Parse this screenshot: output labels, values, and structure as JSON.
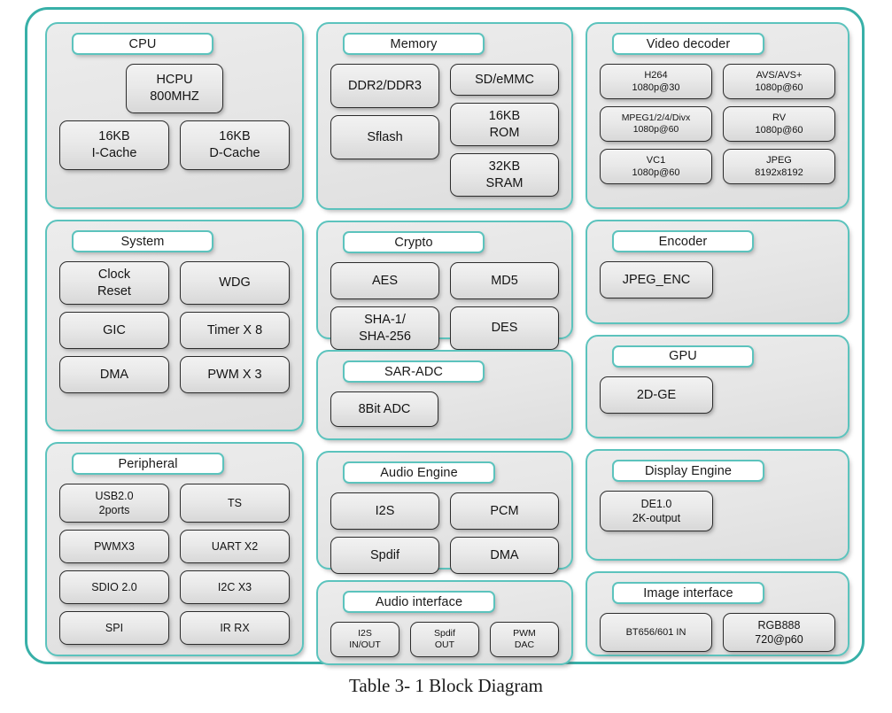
{
  "caption": "Table 3- 1 Block Diagram",
  "colors": {
    "group_border": "#5cc3bd",
    "frame_border": "#38b0a8",
    "block_border": "#2c2c2c",
    "group_fill": "#e6e6e6",
    "title_fill": "#ffffff"
  },
  "columns": {
    "left": {
      "groups": [
        {
          "title": "CPU",
          "blocks": [
            {
              "line1": "HCPU",
              "line2": "800MHZ"
            },
            {
              "line1": "16KB",
              "line2": "I-Cache"
            },
            {
              "line1": "16KB",
              "line2": "D-Cache"
            }
          ]
        },
        {
          "title": "System",
          "blocks": [
            {
              "line1": "Clock",
              "line2": "Reset"
            },
            {
              "line1": "WDG",
              "line2": ""
            },
            {
              "line1": "GIC",
              "line2": ""
            },
            {
              "line1": "Timer X 8",
              "line2": ""
            },
            {
              "line1": "DMA",
              "line2": ""
            },
            {
              "line1": "PWM X 3",
              "line2": ""
            }
          ]
        },
        {
          "title": "Peripheral",
          "blocks": [
            {
              "line1": "USB2.0",
              "line2": "2ports"
            },
            {
              "line1": "TS",
              "line2": ""
            },
            {
              "line1": "PWMX3",
              "line2": ""
            },
            {
              "line1": "UART X2",
              "line2": ""
            },
            {
              "line1": "SDIO 2.0",
              "line2": ""
            },
            {
              "line1": "I2C X3",
              "line2": ""
            },
            {
              "line1": "SPI",
              "line2": ""
            },
            {
              "line1": "IR RX",
              "line2": ""
            }
          ]
        }
      ]
    },
    "middle": {
      "groups": [
        {
          "title": "Memory",
          "blocks": [
            {
              "line1": "DDR2/DDR3",
              "line2": ""
            },
            {
              "line1": "Sflash",
              "line2": ""
            },
            {
              "line1": "SD/eMMC",
              "line2": ""
            },
            {
              "line1": "16KB",
              "line2": "ROM"
            },
            {
              "line1": "32KB",
              "line2": "SRAM"
            }
          ]
        },
        {
          "title": "Crypto",
          "blocks": [
            {
              "line1": "AES",
              "line2": ""
            },
            {
              "line1": "MD5",
              "line2": ""
            },
            {
              "line1": "SHA-1/",
              "line2": "SHA-256"
            },
            {
              "line1": "DES",
              "line2": ""
            }
          ]
        },
        {
          "title": "SAR-ADC",
          "blocks": [
            {
              "line1": "8Bit ADC",
              "line2": ""
            }
          ]
        },
        {
          "title": "Audio Engine",
          "blocks": [
            {
              "line1": "I2S",
              "line2": ""
            },
            {
              "line1": "PCM",
              "line2": ""
            },
            {
              "line1": "Spdif",
              "line2": ""
            },
            {
              "line1": "DMA",
              "line2": ""
            }
          ]
        },
        {
          "title": "Audio interface",
          "blocks": [
            {
              "line1": "I2S",
              "line2": "IN/OUT"
            },
            {
              "line1": "Spdif",
              "line2": "OUT"
            },
            {
              "line1": "PWM",
              "line2": "DAC"
            }
          ]
        }
      ]
    },
    "right": {
      "groups": [
        {
          "title": "Video decoder",
          "blocks": [
            {
              "line1": "H264",
              "line2": "1080p@30"
            },
            {
              "line1": "AVS/AVS+",
              "line2": "1080p@60"
            },
            {
              "line1": "MPEG1/2/4/Divx",
              "line2": "1080p@60"
            },
            {
              "line1": "RV",
              "line2": "1080p@60"
            },
            {
              "line1": "VC1",
              "line2": "1080p@60"
            },
            {
              "line1": "JPEG",
              "line2": "8192x8192"
            }
          ]
        },
        {
          "title": "Encoder",
          "blocks": [
            {
              "line1": "JPEG_ENC",
              "line2": ""
            }
          ]
        },
        {
          "title": "GPU",
          "blocks": [
            {
              "line1": "2D-GE",
              "line2": ""
            }
          ]
        },
        {
          "title": "Display Engine",
          "blocks": [
            {
              "line1": "DE1.0",
              "line2": "2K-output"
            }
          ]
        },
        {
          "title": "Image interface",
          "blocks": [
            {
              "line1": "BT656/601 IN",
              "line2": ""
            },
            {
              "line1": "RGB888",
              "line2": "720@p60"
            }
          ]
        }
      ]
    }
  }
}
